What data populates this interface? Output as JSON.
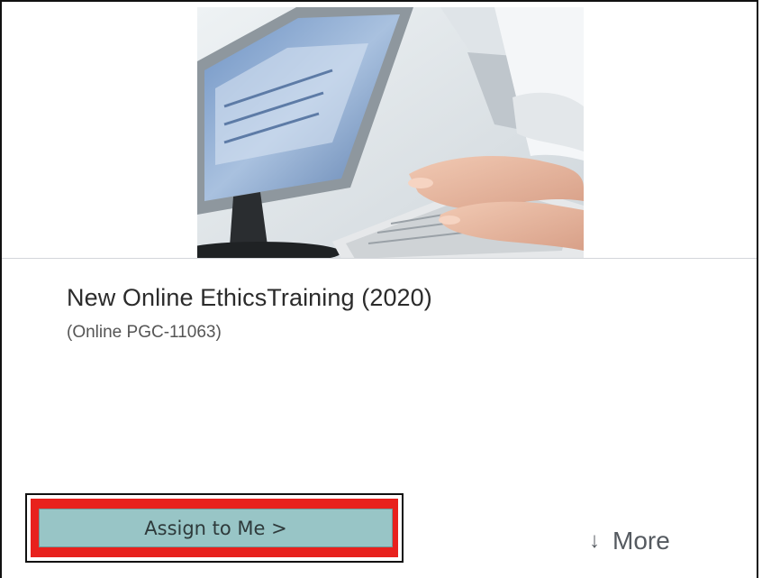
{
  "course": {
    "title": "New Online EthicsTraining (2020)",
    "code": "(Online PGC-11063)",
    "image": "person-typing-at-computer-keyboard"
  },
  "actions": {
    "assign_label": "Assign to Me >",
    "more_icon": "↓",
    "more_label": "More"
  },
  "colors": {
    "assign_button": "#98c5c6",
    "highlight": "#e8211d"
  }
}
